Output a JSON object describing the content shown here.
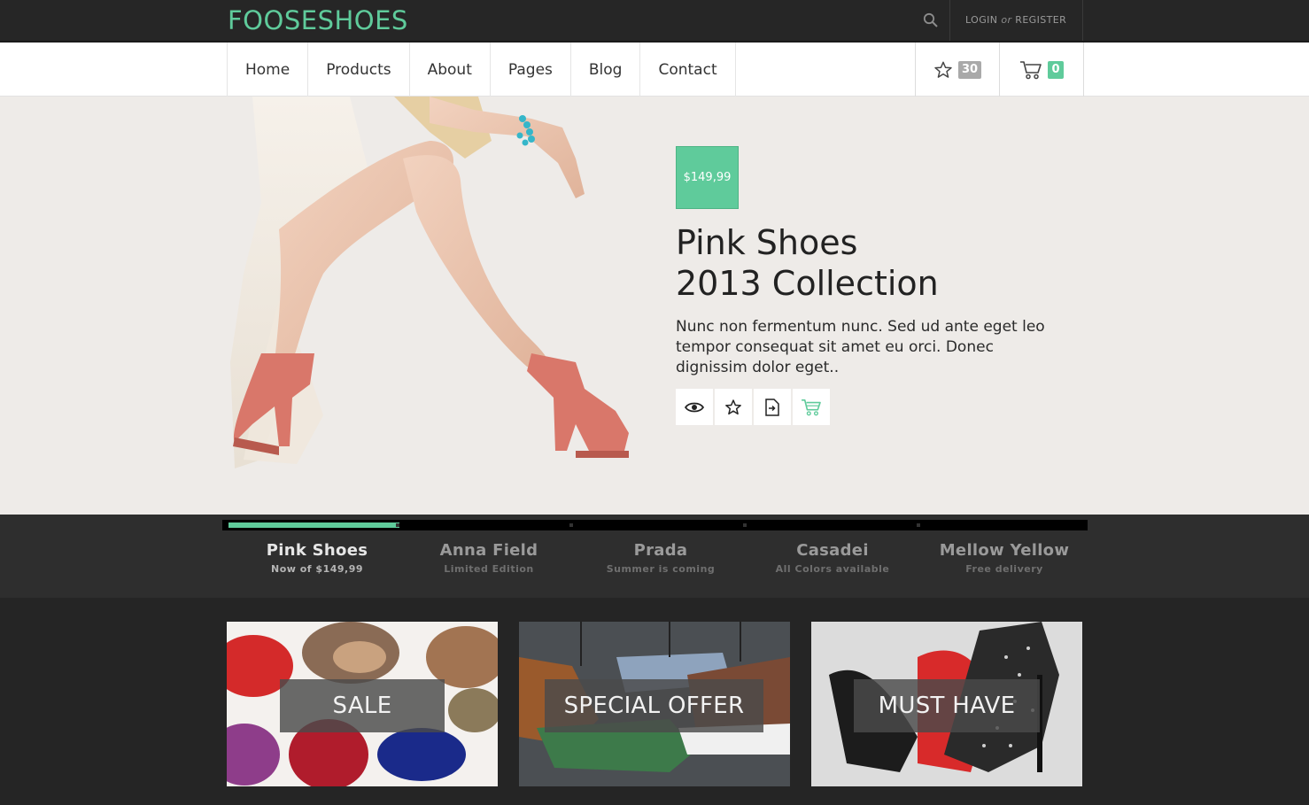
{
  "brand": {
    "logo": "FOOSESHOES",
    "accent": "#5fcb9b",
    "dark": "#262626"
  },
  "topbar": {
    "login": "LOGIN",
    "or": "or",
    "register": "REGISTER",
    "search_icon": "search-icon"
  },
  "nav": {
    "items": [
      {
        "label": "Home"
      },
      {
        "label": "Products"
      },
      {
        "label": "About"
      },
      {
        "label": "Pages"
      },
      {
        "label": "Blog"
      },
      {
        "label": "Contact"
      }
    ],
    "wishlist_count": "30",
    "cart_count": "0"
  },
  "hero": {
    "price": "$149,99",
    "title_line1": "Pink Shoes",
    "title_line2": "2013 Collection",
    "description": "Nunc non fermentum nunc. Sed ud ante eget leo tempor consequat sit amet eu orci. Donec dignissim dolor eget..",
    "actions": [
      "eye-icon",
      "star-icon",
      "document-icon",
      "cart-icon"
    ]
  },
  "slider": {
    "progress": 0.2,
    "tabs": [
      {
        "title": "Pink Shoes",
        "subtitle": "Now of $149,99"
      },
      {
        "title": "Anna Field",
        "subtitle": "Limited Edition"
      },
      {
        "title": "Prada",
        "subtitle": "Summer is coming"
      },
      {
        "title": "Casadei",
        "subtitle": "All Colors available"
      },
      {
        "title": "Mellow Yellow",
        "subtitle": "Free delivery"
      }
    ]
  },
  "promos": [
    {
      "label": "SALE"
    },
    {
      "label": "SPECIAL OFFER"
    },
    {
      "label": "MUST HAVE"
    }
  ]
}
